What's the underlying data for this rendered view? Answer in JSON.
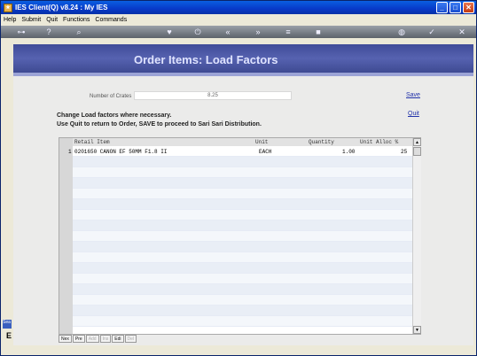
{
  "window": {
    "title": "IES Client(Q) v8.24 : My IES"
  },
  "menu": [
    "Help",
    "Submit",
    "Quit",
    "Functions",
    "Commands"
  ],
  "banner": {
    "title": "Order Items: Load Factors"
  },
  "form": {
    "crates_label": "Number of Crates",
    "crates_value": "8.25"
  },
  "actions": {
    "save": "Save",
    "quit": "Quit"
  },
  "instructions": [
    "Change Load factors where necessary.",
    "Use Quit to return to Order, SAVE to proceed to Sari Sari Distribution."
  ],
  "grid": {
    "columns": [
      "Retail Item",
      "Unit",
      "Quantity",
      "Unit Alloc %"
    ],
    "rows": [
      {
        "num": "1",
        "item": "0201650 CANON EF 50MM F1.8 II",
        "unit": "EACH",
        "qty": "1.00",
        "alloc": "25"
      }
    ]
  },
  "bottom_buttons": [
    {
      "label": "Nex",
      "enabled": true
    },
    {
      "label": "Pre",
      "enabled": true
    },
    {
      "label": "Add",
      "enabled": false
    },
    {
      "label": "Ins",
      "enabled": false
    },
    {
      "label": "Edi",
      "enabled": true
    },
    {
      "label": "Del",
      "enabled": false
    }
  ],
  "side": {
    "tab_label": "Sea",
    "letter": "E"
  }
}
